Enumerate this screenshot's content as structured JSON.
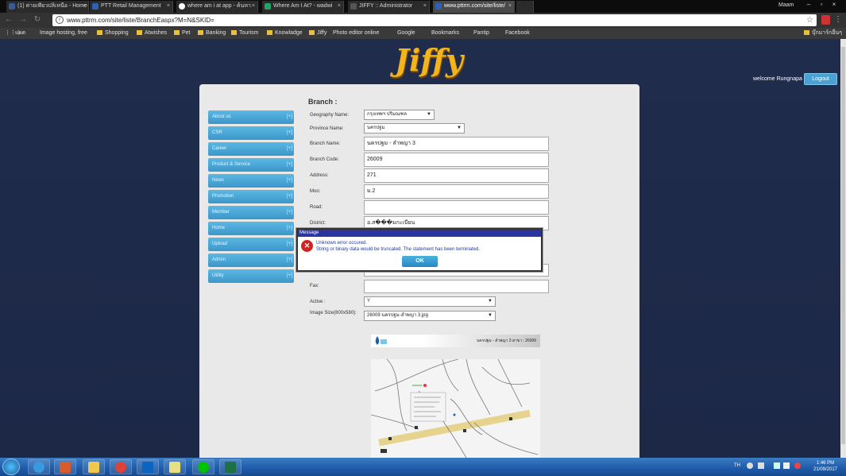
{
  "browser": {
    "tabs": [
      {
        "label": "(1) ค่ายเพียวปลิเหนือ - Home",
        "color": "#3b5998"
      },
      {
        "label": "PTT Retail Management",
        "color": "#2d62b8"
      },
      {
        "label": "where am i at app - ค้นหา",
        "color": "#ffffff"
      },
      {
        "label": "Where Am I At? - wadwi",
        "color": "#1fa463"
      },
      {
        "label": "JIFFY :: Administrator",
        "color": "#555555"
      },
      {
        "label": "www.pttrm.com/site/liste/",
        "color": "#2d62b8"
      }
    ],
    "profile": "Maam",
    "url": "www.pttrm.com/site/liste/BranchEaspx?M=N&SKID=",
    "bookmarks": [
      "แผด",
      "Image hosting, free",
      "Shopping",
      "Atwishes",
      "Pet",
      "Banking",
      "Tourism",
      "Knowladge",
      "Jiffy",
      "Photo editor online",
      "Google",
      "Bookmarks",
      "Pantip",
      "Facebook",
      "บุ๊กมาร์กอื่นๆ"
    ]
  },
  "site": {
    "logo": "Jiffy",
    "welcome": "welcome Rungnapa",
    "logout": "Logout",
    "sidebar": [
      "About us",
      "CSR",
      "Career",
      "Product & Service",
      "News",
      "Promotion",
      "Member",
      "Home",
      "Upload",
      "Admin",
      "Utility"
    ],
    "sidebar_plus": "[+]",
    "form": {
      "title": "Branch :",
      "geography_label": "Geography Name:",
      "geography_value": "กรุงเทพฯ ปริมณฑล",
      "province_label": "Province Name:",
      "province_value": "นครปฐม",
      "branch_name_label": "Branch Name:",
      "branch_name_value": "นครปฐม - ลำพญา 3",
      "branch_code_label": "Branch Code:",
      "branch_code_value": "26009",
      "address_label": "Address:",
      "address_value": "271",
      "moo_label": "Moo:",
      "moo_value": "ม.2",
      "road_label": "Road:",
      "road_value": "",
      "district_label": "District:",
      "district_value": "อ.ส���มกะเบียน",
      "fax_label": "Fax:",
      "fax_value": "",
      "active_label": "Active :",
      "active_value": "Y",
      "image_size_label": "Image Size(800x580):",
      "image_size_value": "26009 นครปฐม-ลำพญา 3.jpg"
    },
    "preview_caption": "นครปฐม - ลำพญา 3 สาขา : 26009"
  },
  "dialog": {
    "title": "Message",
    "line1": "Unknown error occured.",
    "line2": "String or binary data would be truncated. The statement has been terminated.",
    "ok": "OK"
  },
  "taskbar": {
    "lang": "TH",
    "time": "1:46 PM",
    "date": "21/09/2017"
  }
}
